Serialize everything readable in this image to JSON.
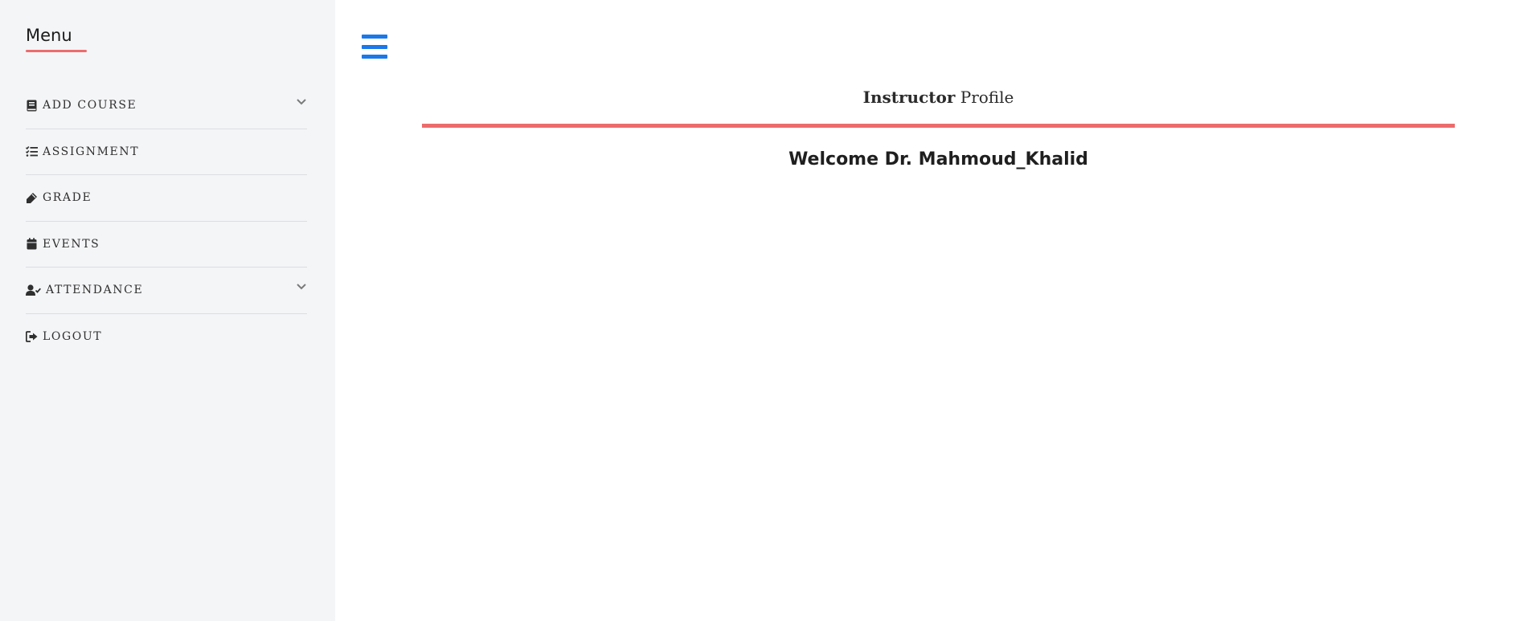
{
  "sidebar": {
    "title": "Menu",
    "items": [
      {
        "label": "ADD COURSE",
        "icon": "book-icon",
        "has_dropdown": true
      },
      {
        "label": "ASSIGNMENT",
        "icon": "list-check-icon",
        "has_dropdown": false
      },
      {
        "label": "GRADE",
        "icon": "marker-icon",
        "has_dropdown": false
      },
      {
        "label": "EVENTS",
        "icon": "calendar-icon",
        "has_dropdown": false
      },
      {
        "label": "ATTENDANCE",
        "icon": "user-check-icon",
        "has_dropdown": true
      },
      {
        "label": "LOGOUT",
        "icon": "sign-out-icon",
        "has_dropdown": false
      }
    ]
  },
  "main": {
    "header_bold": "Instructor",
    "header_rest": " Profile",
    "welcome": "Welcome Dr. Mahmoud_Khalid"
  },
  "colors": {
    "accent_red": "#ec6c6c",
    "hamburger_blue": "#1b78e8",
    "sidebar_bg": "#f4f5f7"
  }
}
